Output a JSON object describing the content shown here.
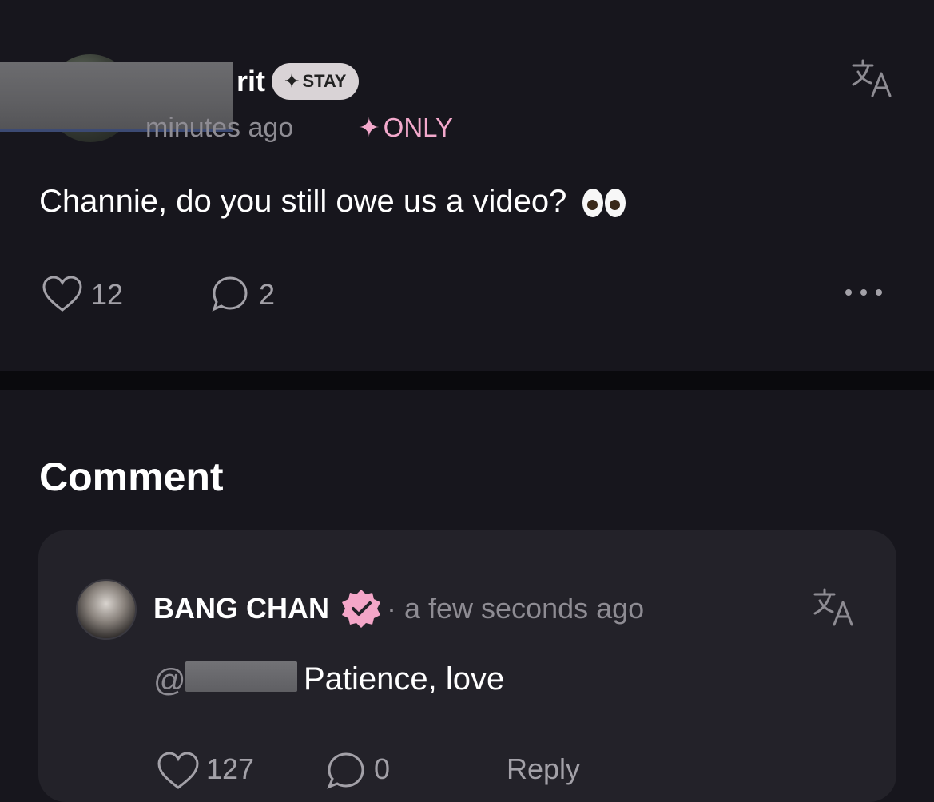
{
  "post": {
    "author_suffix": "rit",
    "badge_label": "STAY",
    "badge_icon": "sparkle-icon",
    "time_visible": "minutes ago",
    "only_label": "ONLY",
    "only_color": "#f3a9cc",
    "text": "Channie, do you still owe us a video?",
    "emoji": "eyes-emoji",
    "likes": "12",
    "comments": "2"
  },
  "comments_section": {
    "title": "Comment",
    "items": [
      {
        "author": "BANG CHAN",
        "verified_color": "#f4a6c8",
        "time": "· a few seconds ago",
        "mention_prefix": "@",
        "text": "Patience, love",
        "likes": "127",
        "comments": "0",
        "reply_label": "Reply"
      }
    ]
  }
}
